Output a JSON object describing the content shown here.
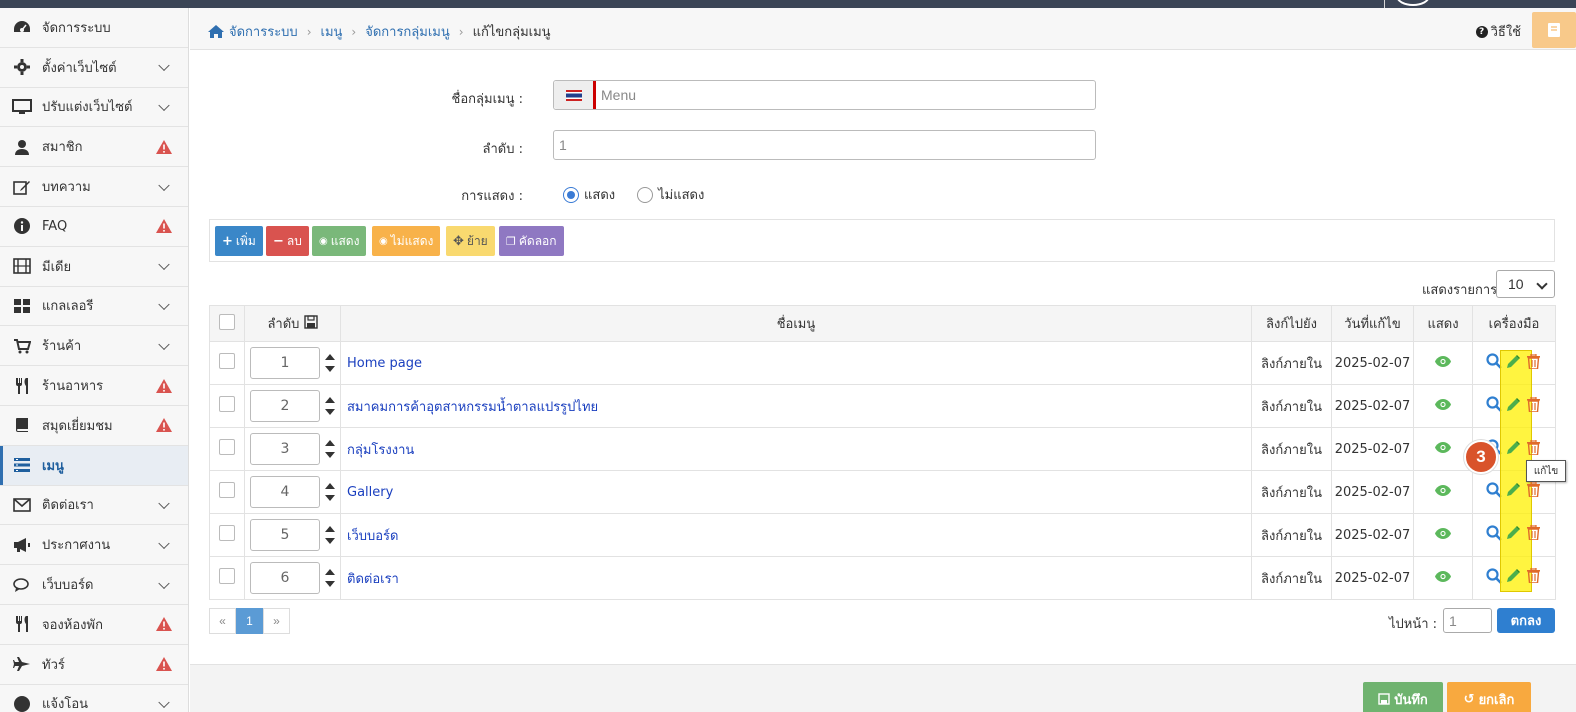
{
  "sidebar": {
    "items": [
      {
        "label": "จัดการระบบ",
        "icon": "dashboard-icon",
        "chevron": false,
        "warn": false
      },
      {
        "label": "ตั้งค่าเว็บไซต์",
        "icon": "gear-icon",
        "chevron": true,
        "warn": false
      },
      {
        "label": "ปรับแต่งเว็บไซต์",
        "icon": "monitor-icon",
        "chevron": true,
        "warn": false
      },
      {
        "label": "สมาชิก",
        "icon": "user-icon",
        "chevron": false,
        "warn": true
      },
      {
        "label": "บทความ",
        "icon": "edit-icon",
        "chevron": true,
        "warn": false
      },
      {
        "label": "FAQ",
        "icon": "info-icon",
        "chevron": false,
        "warn": true
      },
      {
        "label": "มีเดีย",
        "icon": "film-icon",
        "chevron": true,
        "warn": false
      },
      {
        "label": "แกลเลอรี",
        "icon": "grid-icon",
        "chevron": true,
        "warn": false
      },
      {
        "label": "ร้านค้า",
        "icon": "cart-icon",
        "chevron": true,
        "warn": false
      },
      {
        "label": "ร้านอาหาร",
        "icon": "utensils-icon",
        "chevron": false,
        "warn": true
      },
      {
        "label": "สมุดเยี่ยมชม",
        "icon": "book-icon",
        "chevron": false,
        "warn": true
      },
      {
        "label": "เมนู",
        "icon": "menu-icon",
        "chevron": false,
        "warn": false,
        "active": true
      },
      {
        "label": "ติดต่อเรา",
        "icon": "envelope-icon",
        "chevron": true,
        "warn": false
      },
      {
        "label": "ประกาศงาน",
        "icon": "megaphone-icon",
        "chevron": true,
        "warn": false
      },
      {
        "label": "เว็บบอร์ด",
        "icon": "comments-icon",
        "chevron": true,
        "warn": false
      },
      {
        "label": "จองห้องพัก",
        "icon": "utensils-icon",
        "chevron": false,
        "warn": true
      },
      {
        "label": "ทัวร์",
        "icon": "plane-icon",
        "chevron": false,
        "warn": true
      },
      {
        "label": "แจ้งโอน",
        "icon": "money-icon",
        "chevron": true,
        "warn": false
      }
    ]
  },
  "breadcrumb": {
    "items": [
      "จัดการระบบ",
      "เมนู",
      "จัดการกลุ่มเมนู"
    ],
    "current": "แก้ไขกลุ่มเมนู"
  },
  "help": {
    "label": "วิธีใช้"
  },
  "form": {
    "group_name_label": "ชื่อกลุ่มเมนู :",
    "group_name_placeholder": "Menu",
    "order_label": "ลำดับ :",
    "order_value": "1",
    "display_label": "การแสดง :",
    "display_show": "แสดง",
    "display_hide": "ไม่แสดง",
    "display_selected": "แสดง"
  },
  "toolbar": {
    "add": "เพิ่ม",
    "delete": "ลบ",
    "show": "แสดง",
    "hide": "ไม่แสดง",
    "move": "ย้าย",
    "copy": "คัดลอก"
  },
  "per_page": {
    "label": "แสดงรายการ",
    "value": "10"
  },
  "table": {
    "headers": {
      "order": "ลำดับ",
      "name": "ชื่อเมนู",
      "link": "ลิงก์ไปยัง",
      "date": "วันที่แก้ไข",
      "show": "แสดง",
      "tools": "เครื่องมือ"
    },
    "rows": [
      {
        "order": "1",
        "name": "Home page",
        "link": "ลิงก์ภายใน",
        "date": "2025-02-07"
      },
      {
        "order": "2",
        "name": "สมาคมการค้าอุตสาหกรรมน้ำตาลแปรรูปไทย",
        "link": "ลิงก์ภายใน",
        "date": "2025-02-07"
      },
      {
        "order": "3",
        "name": "กลุ่มโรงงาน",
        "link": "ลิงก์ภายใน",
        "date": "2025-02-07"
      },
      {
        "order": "4",
        "name": "Gallery",
        "link": "ลิงก์ภายใน",
        "date": "2025-02-07"
      },
      {
        "order": "5",
        "name": "เว็บบอร์ด",
        "link": "ลิงก์ภายใน",
        "date": "2025-02-07"
      },
      {
        "order": "6",
        "name": "ติดต่อเรา",
        "link": "ลิงก์ภายใน",
        "date": "2025-02-07"
      }
    ]
  },
  "annotation": {
    "step": "3",
    "tooltip": "แก้ไข"
  },
  "pagination": {
    "prev": "«",
    "current": "1",
    "next": "»"
  },
  "goto": {
    "label": "ไปหน้า :",
    "value": "1",
    "button": "ตกลง"
  },
  "footer": {
    "save": "บันทึก",
    "cancel": "ยกเลิก"
  },
  "colors": {
    "add": "#3a87c8",
    "delete": "#d9534f",
    "show": "#7ab87a",
    "hide": "#f8b24a",
    "move": "#f9d96f",
    "copy": "#8f78c2",
    "save": "#6fb36f",
    "cancel": "#f8a93f"
  }
}
